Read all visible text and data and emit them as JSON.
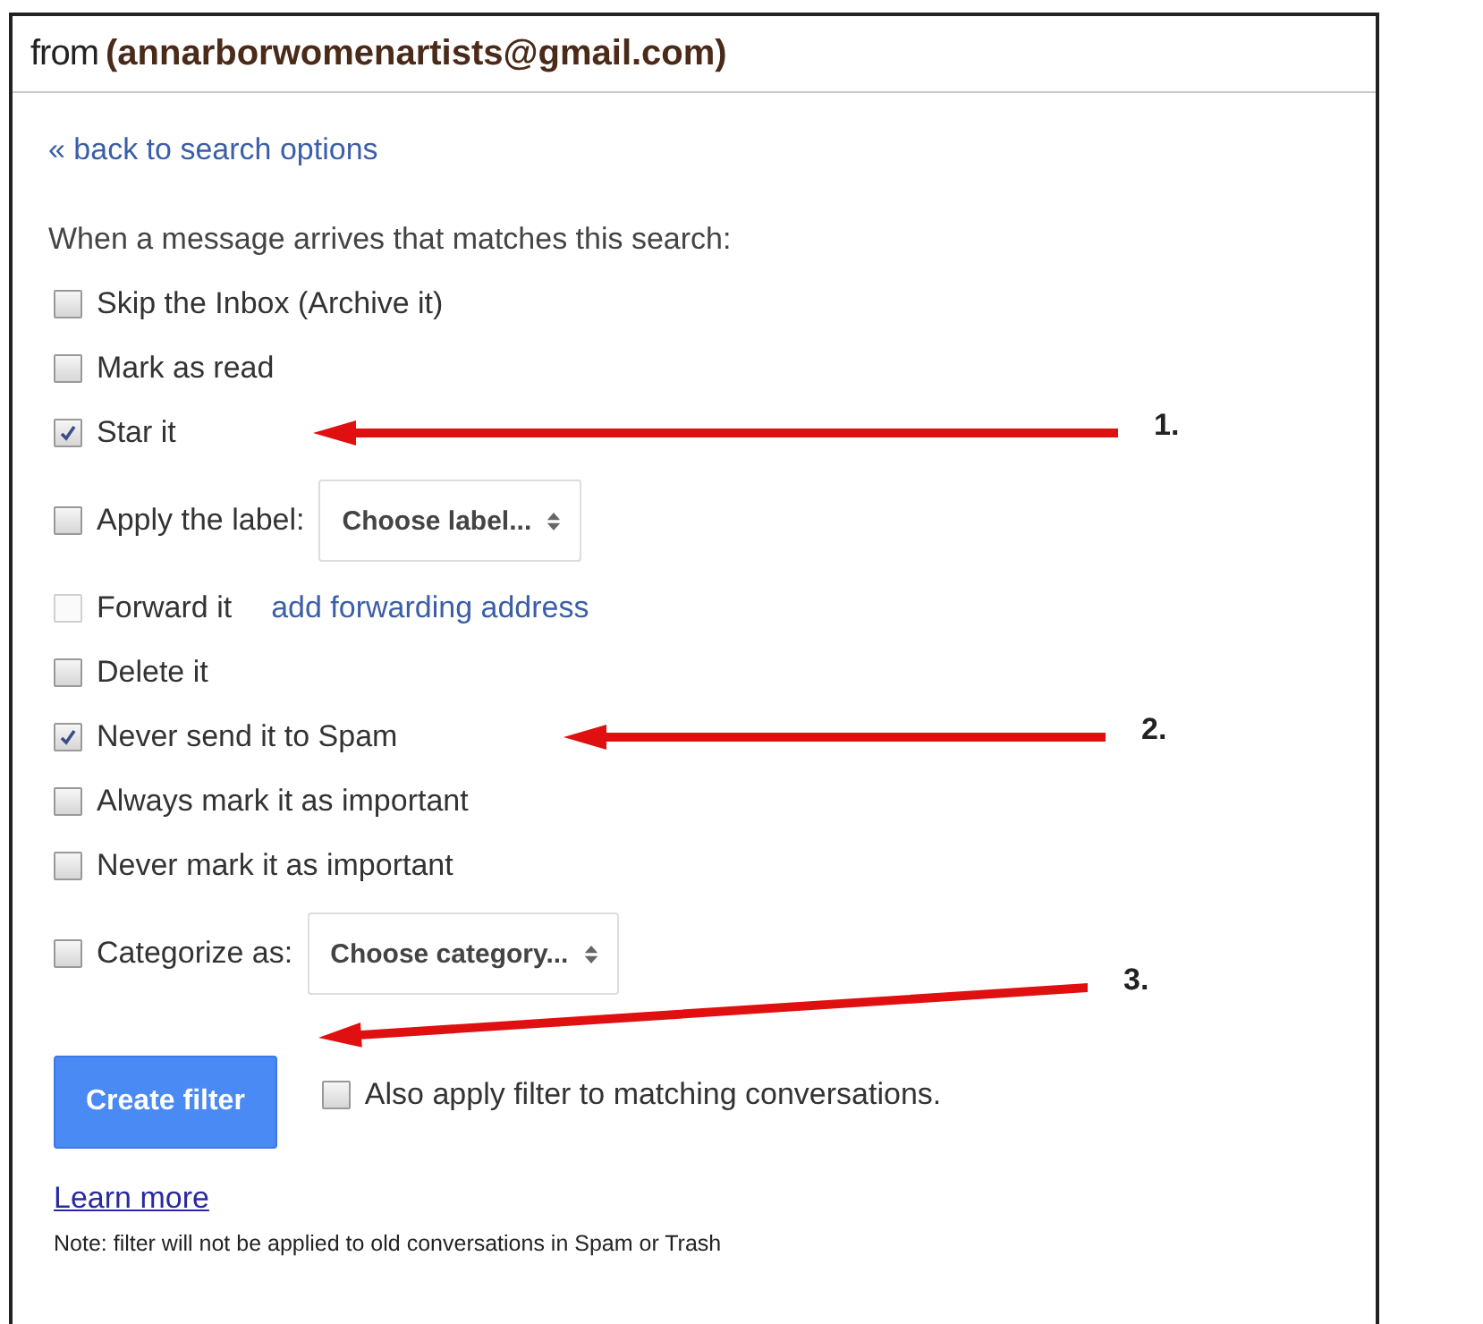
{
  "header": {
    "prefix": "from",
    "query": "(annarborwomenartists@gmail.com)"
  },
  "back_link": "« back to search options",
  "instruction": "When a message arrives that matches this search:",
  "options": [
    {
      "kind": "plain",
      "label": "Skip the Inbox (Archive it)",
      "checked": false
    },
    {
      "kind": "plain",
      "label": "Mark as read",
      "checked": false
    },
    {
      "kind": "plain",
      "label": "Star it",
      "checked": true
    },
    {
      "kind": "select",
      "label": "Apply the label:",
      "checked": false,
      "select": "Choose label..."
    },
    {
      "kind": "link",
      "label": "Forward it",
      "checked": false,
      "disabled": true,
      "link": "add forwarding address"
    },
    {
      "kind": "plain",
      "label": "Delete it",
      "checked": false
    },
    {
      "kind": "plain",
      "label": "Never send it to Spam",
      "checked": true
    },
    {
      "kind": "plain",
      "label": "Always mark it as important",
      "checked": false
    },
    {
      "kind": "plain",
      "label": "Never mark it as important",
      "checked": false
    },
    {
      "kind": "select",
      "label": "Categorize as:",
      "checked": false,
      "select": "Choose category..."
    }
  ],
  "create_button": "Create filter",
  "also_apply": {
    "label": "Also apply filter to matching conversations.",
    "checked": false
  },
  "learn_more": "Learn more",
  "note": "Note: filter will not be applied to old conversations in Spam or Trash",
  "annotations": [
    {
      "label": "1."
    },
    {
      "label": "2."
    },
    {
      "label": "3."
    }
  ]
}
